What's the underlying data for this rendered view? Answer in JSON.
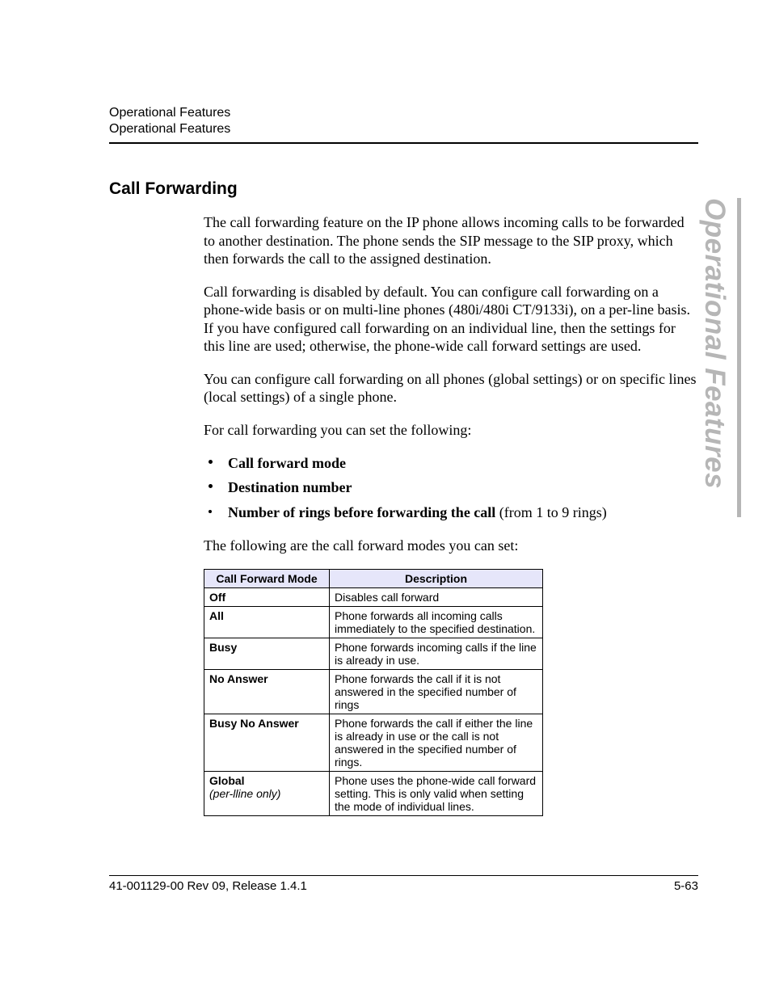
{
  "header": {
    "line1": "Operational Features",
    "line2": "Operational Features"
  },
  "section_title": "Call Forwarding",
  "paragraphs": {
    "p1": "The call forwarding feature on the IP phone allows incoming calls to be forwarded to another destination. The phone sends the SIP message to the SIP proxy, which then forwards the call to the assigned destination.",
    "p2": "Call forwarding is disabled by default. You can configure call forwarding on a phone-wide basis or on multi-line phones (480i/480i CT/9133i), on a per-line basis.  If you have configured call forwarding on an individual line, then the settings for this line are used; otherwise, the phone-wide call forward settings are used.",
    "p3": "You can configure call forwarding on all phones (global settings) or on specific lines (local settings) of a single phone.",
    "p4": "For call forwarding you can set the following:",
    "p5": "The following are the call forward modes you can set:"
  },
  "bullets": {
    "b1": "Call forward mode",
    "b2": "Destination number",
    "b3_bold": "Number of rings before forwarding the call",
    "b3_rest": " (from 1 to 9 rings)"
  },
  "table": {
    "h1": "Call Forward Mode",
    "h2": "Description",
    "rows": [
      {
        "mode": "Off",
        "mode_sub": "",
        "desc": "Disables call forward"
      },
      {
        "mode": "All",
        "mode_sub": "",
        "desc": "Phone forwards all incoming calls immediately to the specified destination."
      },
      {
        "mode": "Busy",
        "mode_sub": "",
        "desc": "Phone forwards incoming calls if the line is already in use."
      },
      {
        "mode": "No Answer",
        "mode_sub": "",
        "desc": "Phone forwards the call if it is not answered in the specified number of rings"
      },
      {
        "mode": "Busy No Answer",
        "mode_sub": "",
        "desc": "Phone forwards the call if either the line is already in use or the call is not answered in the specified number of rings."
      },
      {
        "mode": "Global",
        "mode_sub": "(per-lline only)",
        "desc": "Phone uses the phone-wide call forward setting.  This is only valid when setting the mode of individual lines."
      }
    ]
  },
  "side_tab": "Operational Features",
  "footer": {
    "left": "41-001129-00 Rev 09, Release 1.4.1",
    "right": "5-63"
  }
}
